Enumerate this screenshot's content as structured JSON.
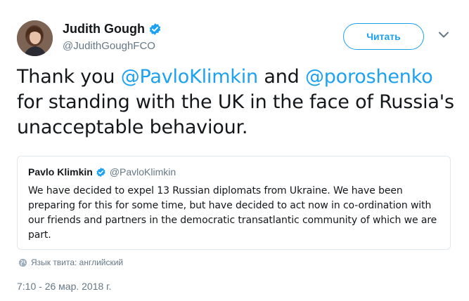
{
  "author": {
    "name": "Judith Gough",
    "handle": "@JudithGoughFCO",
    "avatar_icon": "profile-photo"
  },
  "follow_button": {
    "label": "Читать"
  },
  "tweet": {
    "parts": [
      {
        "text": "Thank you ",
        "type": "text"
      },
      {
        "text": "@PavloKlimkin",
        "type": "mention"
      },
      {
        "text": " and ",
        "type": "text"
      },
      {
        "text": "@poroshenko",
        "type": "mention"
      },
      {
        "text": " for standing with the UK in the face of Russia's unacceptable behaviour.",
        "type": "text"
      }
    ]
  },
  "quoted_tweet": {
    "name": "Pavlo Klimkin",
    "handle": "@PavloKlimkin",
    "text": "We have decided to expel 13 Russian diplomats from Ukraine. We have been preparing for this for some time, but have decided to act now in co-ordination with our friends and partners in the democratic transatlantic community of which we are part."
  },
  "language_note": "Язык твита: английский",
  "timestamp": "7:10 - 26 мар. 2018 г.",
  "colors": {
    "accent": "#1da1f2",
    "secondary_text": "#657786",
    "primary_text": "#14171a",
    "border": "#e1e8ed"
  }
}
